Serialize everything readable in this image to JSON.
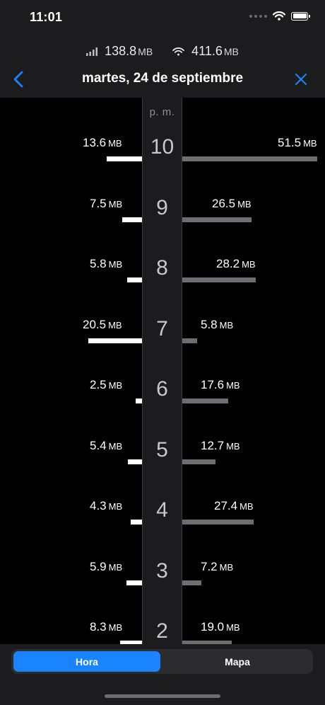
{
  "status_bar": {
    "time": "11:01"
  },
  "summary": {
    "cellular_value": "138.8",
    "cellular_unit": "MB",
    "wifi_value": "411.6",
    "wifi_unit": "MB"
  },
  "nav": {
    "title": "martes, 24 de septiembre"
  },
  "period_label": "p. m.",
  "chart_data": {
    "type": "bar",
    "unit": "MB",
    "categories": [
      "10",
      "9",
      "8",
      "7",
      "6",
      "5",
      "4",
      "3",
      "2"
    ],
    "series": [
      {
        "values": [
          13.6,
          7.5,
          5.8,
          20.5,
          2.5,
          5.4,
          4.3,
          5.9,
          8.3
        ],
        "color": "#ffffff"
      },
      {
        "values": [
          51.5,
          26.5,
          28.2,
          5.8,
          17.6,
          12.7,
          27.4,
          7.2,
          19.0
        ],
        "color": "#6e6e70"
      }
    ],
    "labels_left": [
      "13.6",
      "7.5",
      "5.8",
      "20.5",
      "2.5",
      "5.4",
      "4.3",
      "5.9",
      "8.3"
    ],
    "labels_right": [
      "51.5",
      "26.5",
      "28.2",
      "5.8",
      "17.6",
      "12.7",
      "27.4",
      "7.2",
      "19.0"
    ]
  },
  "tabs": {
    "hour_label": "Hora",
    "map_label": "Mapa"
  },
  "colors": {
    "accent": "#1a84ff",
    "background": "#000000",
    "panel": "#1c1c1e"
  }
}
